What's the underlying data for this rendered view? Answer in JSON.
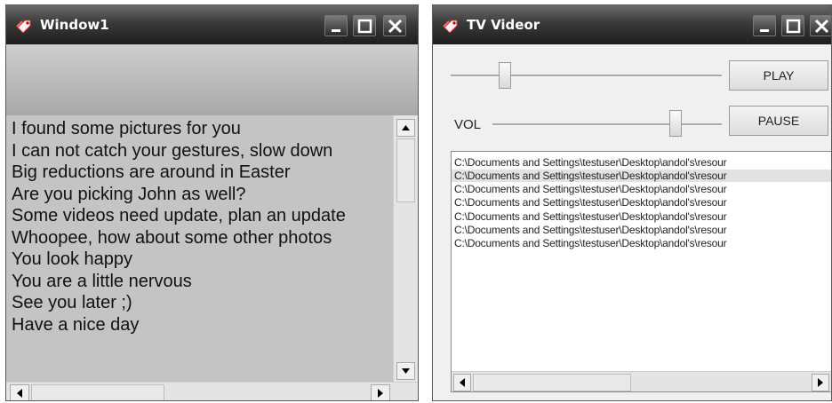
{
  "window1": {
    "title": "Window1",
    "messages": [
      "I found some pictures for you",
      "I can not catch your gestures, slow down",
      "Big reductions are around in Easter",
      "Are you picking John as well?",
      "Some videos need update, plan an update",
      "Whoopee, how about some other photos",
      "You look happy",
      "You are a little nervous",
      "See you later ;)",
      "Have a nice day"
    ]
  },
  "window2": {
    "title": "TV Videor",
    "play_label": "PLAY",
    "pause_label": "PAUSE",
    "vol_label": "VOL",
    "position_fraction": 0.2,
    "volume_fraction": 0.8,
    "files": [
      "C:\\Documents and Settings\\testuser\\Desktop\\andol's\\resour",
      "C:\\Documents and Settings\\testuser\\Desktop\\andol's\\resour",
      "C:\\Documents and Settings\\testuser\\Desktop\\andol's\\resour",
      "C:\\Documents and Settings\\testuser\\Desktop\\andol's\\resour",
      "C:\\Documents and Settings\\testuser\\Desktop\\andol's\\resour",
      "C:\\Documents and Settings\\testuser\\Desktop\\andol's\\resour",
      "C:\\Documents and Settings\\testuser\\Desktop\\andol's\\resour"
    ],
    "selected_file_index": 1
  },
  "icons": {
    "title_icon": "tag-icon",
    "minimize": "minimize-icon",
    "maximize": "maximize-icon",
    "close": "close-icon"
  }
}
